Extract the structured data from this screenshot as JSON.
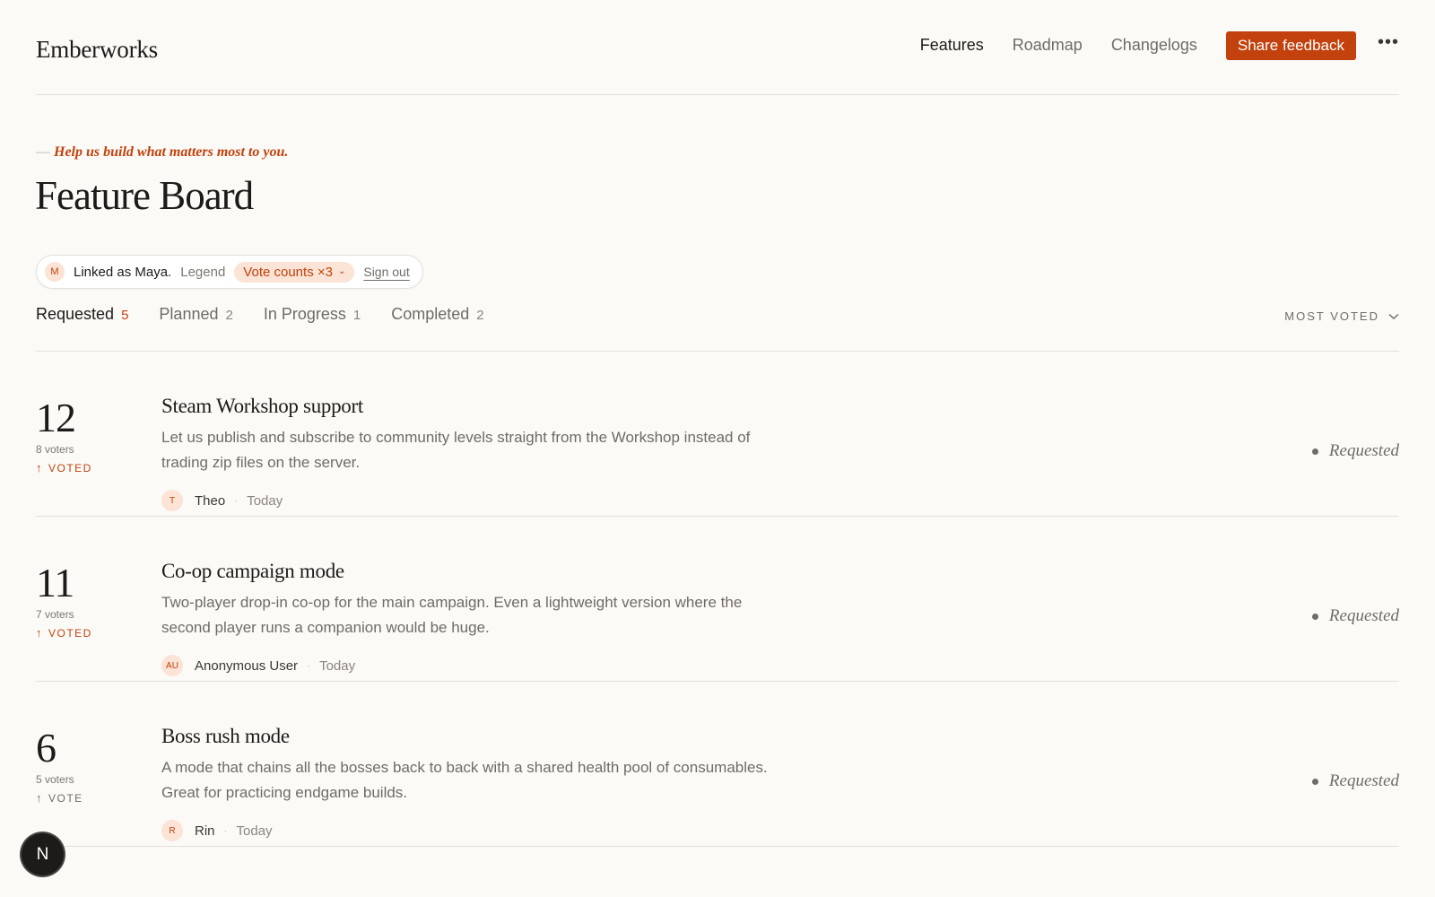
{
  "header": {
    "brand": "Emberworks",
    "nav": [
      {
        "label": "Features",
        "active": true
      },
      {
        "label": "Roadmap",
        "active": false
      },
      {
        "label": "Changelogs",
        "active": false
      }
    ],
    "cta_label": "Share feedback",
    "more_icon": "more-horizontal-icon"
  },
  "hero": {
    "tagline_dash": "—",
    "tagline": "Help us build what matters most to you.",
    "title": "Feature Board"
  },
  "account": {
    "avatar_initial": "M",
    "linked_text": "Linked as Maya.",
    "legend_label": "Legend",
    "vote_counts_label": "Vote counts ×3",
    "sign_out_label": "Sign out"
  },
  "tabs": [
    {
      "label": "Requested",
      "count": "5"
    },
    {
      "label": "Planned",
      "count": "2"
    },
    {
      "label": "In Progress",
      "count": "1"
    },
    {
      "label": "Completed",
      "count": "2"
    }
  ],
  "sort": {
    "label": "MOST VOTED"
  },
  "items": [
    {
      "votes": "12",
      "voters": "8 voters",
      "vote_label": "VOTED",
      "voted": true,
      "title": "Steam Workshop support",
      "description": "Let us publish and subscribe to community levels straight from the Workshop instead of trading zip files on the server.",
      "author_initials": "T",
      "author": "Theo",
      "separator": "·",
      "date": "Today",
      "status": "Requested"
    },
    {
      "votes": "11",
      "voters": "7 voters",
      "vote_label": "VOTED",
      "voted": true,
      "title": "Co-op campaign mode",
      "description": "Two-player drop-in co-op for the main campaign. Even a lightweight version where the second player runs a companion would be huge.",
      "author_initials": "AU",
      "author": "Anonymous User",
      "separator": "·",
      "date": "Today",
      "status": "Requested"
    },
    {
      "votes": "6",
      "voters": "5 voters",
      "vote_label": "VOTE",
      "voted": false,
      "title": "Boss rush mode",
      "description": "A mode that chains all the bosses back to back with a shared health pool of consumables. Great for practicing endgame builds.",
      "author_initials": "R",
      "author": "Rin",
      "separator": "·",
      "date": "Today",
      "status": "Requested"
    }
  ],
  "fab": {
    "label": "N"
  },
  "colors": {
    "accent": "#c2410c",
    "accent_soft": "#fbe3d6",
    "background": "#fbfaf7"
  }
}
